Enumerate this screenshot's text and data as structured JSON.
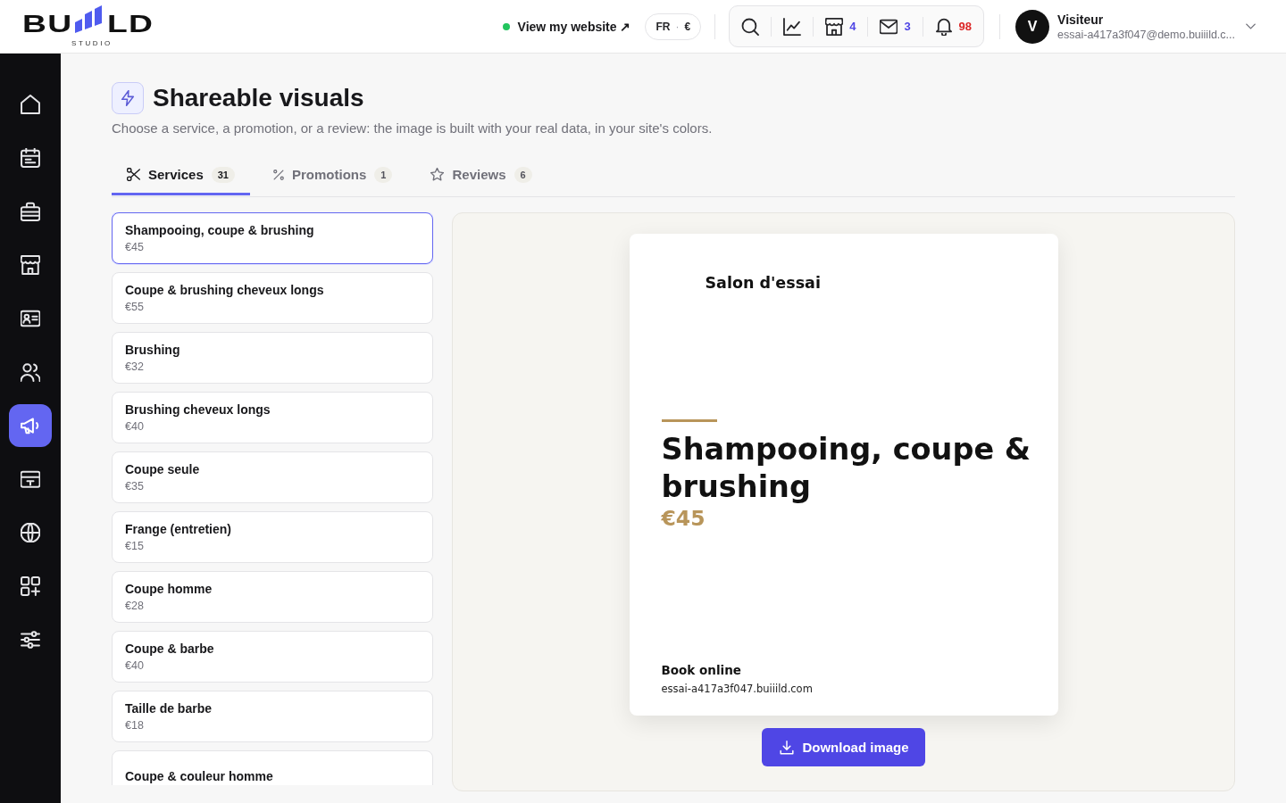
{
  "header": {
    "logo": {
      "left": "BU",
      "right": "LD",
      "tagline": "STUDIO"
    },
    "website_link": "View my website ↗",
    "locale_button": {
      "language": "FR",
      "separator": "·",
      "currency": "€"
    },
    "toolbar": [
      {
        "kind": "search"
      },
      {
        "kind": "chart"
      },
      {
        "kind": "store",
        "count": "4",
        "color": "#4f46e5"
      },
      {
        "kind": "mail",
        "count": "3",
        "color": "#4f46e5"
      },
      {
        "kind": "bell",
        "count": "98",
        "color": "#dc2626"
      }
    ],
    "user": {
      "initial": "V",
      "name": "Visiteur",
      "email": "essai-a417a3f047@demo.buiiild.c..."
    }
  },
  "sidebar": {
    "items": [
      {
        "kind": "home",
        "selected": false
      },
      {
        "kind": "calendar",
        "selected": false
      },
      {
        "kind": "briefcase",
        "selected": false
      },
      {
        "kind": "store",
        "selected": false
      },
      {
        "kind": "contact",
        "selected": false
      },
      {
        "kind": "users",
        "selected": false
      },
      {
        "kind": "megaphone",
        "selected": true
      },
      {
        "kind": "card",
        "selected": false
      },
      {
        "kind": "globe",
        "selected": false
      },
      {
        "kind": "apps",
        "selected": false
      },
      {
        "kind": "sliders",
        "selected": false
      }
    ]
  },
  "page": {
    "title": "Shareable visuals",
    "subtitle": "Choose a service, a promotion, or a review: the image is built with your real data, in your site's colors."
  },
  "tabs": [
    {
      "kind": "scissors",
      "label": "Services",
      "count": "31",
      "selected": true
    },
    {
      "kind": "percent",
      "label": "Promotions",
      "count": "1",
      "selected": false
    },
    {
      "kind": "star",
      "label": "Reviews",
      "count": "6",
      "selected": false
    }
  ],
  "services": [
    {
      "name": "Shampooing, coupe & brushing",
      "price": "€45",
      "selected": true
    },
    {
      "name": "Coupe & brushing cheveux longs",
      "price": "€55",
      "selected": false
    },
    {
      "name": "Brushing",
      "price": "€32",
      "selected": false
    },
    {
      "name": "Brushing cheveux longs",
      "price": "€40",
      "selected": false
    },
    {
      "name": "Coupe seule",
      "price": "€35",
      "selected": false
    },
    {
      "name": "Frange (entretien)",
      "price": "€15",
      "selected": false
    },
    {
      "name": "Coupe homme",
      "price": "€28",
      "selected": false
    },
    {
      "name": "Coupe & barbe",
      "price": "€40",
      "selected": false
    },
    {
      "name": "Taille de barbe",
      "price": "€18",
      "selected": false
    },
    {
      "name": "Coupe & couleur homme",
      "selected": false
    }
  ],
  "preview": {
    "salon_name": "Salon d'essai",
    "title": "Shampooing, coupe & brushing",
    "price": "€45",
    "cta": "Book online",
    "url": "essai-a417a3f047.buiiild.com"
  },
  "download_button": "Download image"
}
